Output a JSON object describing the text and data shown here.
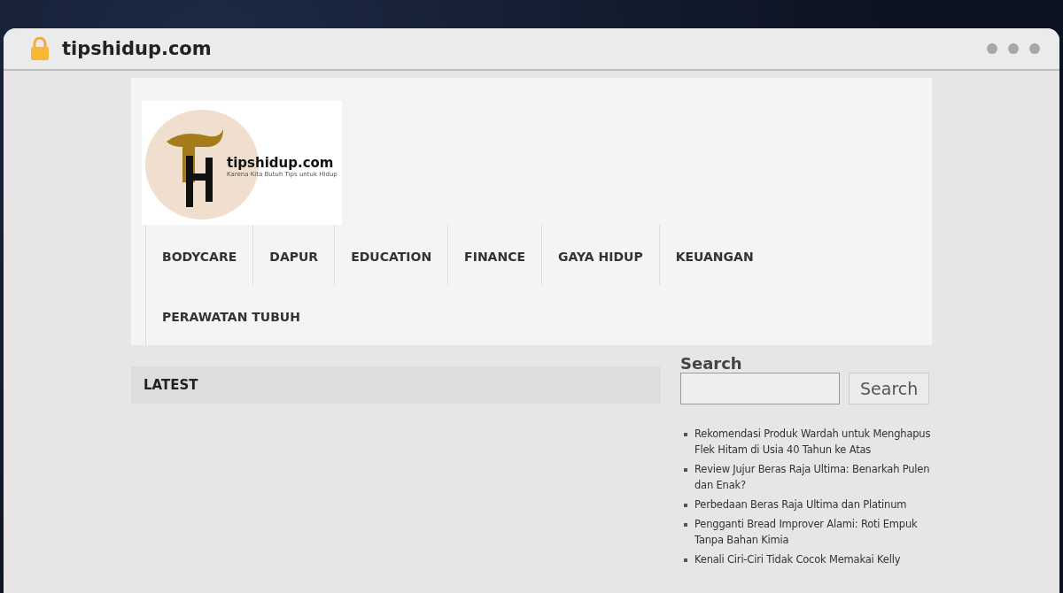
{
  "browser": {
    "url": "tipshidup.com"
  },
  "logo": {
    "title": "tipshidup.com",
    "tagline": "Karena Kita Butuh Tips untuk Hidup"
  },
  "nav": [
    {
      "label": "BODYCARE"
    },
    {
      "label": "DAPUR"
    },
    {
      "label": "EDUCATION"
    },
    {
      "label": "FINANCE"
    },
    {
      "label": "GAYA HIDUP"
    },
    {
      "label": "KEUANGAN"
    },
    {
      "label": "PERAWATAN TUBUH"
    }
  ],
  "main": {
    "heading": "LATEST"
  },
  "sidebar": {
    "search_title": "Search",
    "search_button": "Search",
    "posts": [
      "Rekomendasi Produk Wardah untuk Menghapus Flek Hitam di Usia 40 Tahun ke Atas",
      "Review Jujur Beras Raja Ultima: Benarkah Pulen dan Enak?",
      "Perbedaan Beras Raja Ultima dan Platinum",
      "Pengganti Bread Improver Alami: Roti Empuk Tanpa Bahan Kimia",
      "Kenali Ciri-Ciri Tidak Cocok Memakai Kelly"
    ]
  }
}
